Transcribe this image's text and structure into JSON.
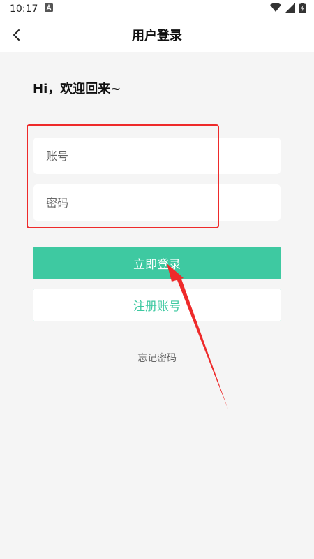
{
  "status_bar": {
    "time": "10:17",
    "icons": [
      "notification-a-icon",
      "wifi-icon",
      "signal-icon",
      "battery-charging-icon"
    ]
  },
  "nav": {
    "back_icon": "back-chevron-icon",
    "title": "用户登录"
  },
  "greeting": "Hi，欢迎回来~",
  "form": {
    "account_placeholder": "账号",
    "password_placeholder": "密码"
  },
  "buttons": {
    "login_label": "立即登录",
    "register_label": "注册账号"
  },
  "forgot_password": "忘记密码",
  "colors": {
    "accent": "#3ec9a1",
    "annotation": "#ee2a2a",
    "background": "#f5f5f5"
  }
}
